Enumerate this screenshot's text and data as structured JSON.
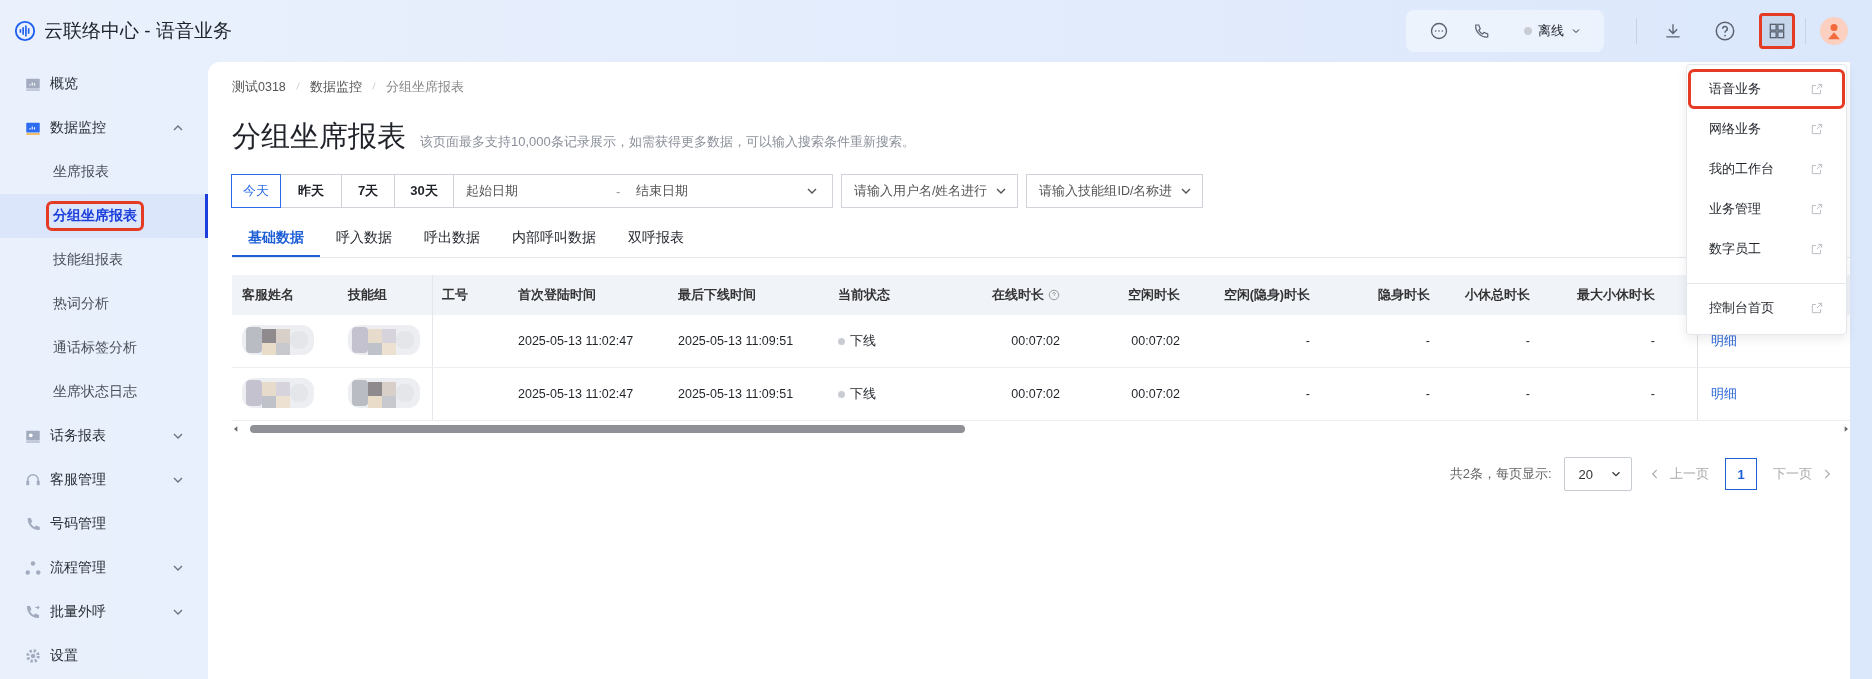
{
  "header": {
    "title": "云联络中心 - 语音业务",
    "agent_status": "离线",
    "apps_button": {
      "highlighted": true
    }
  },
  "sidebar": {
    "items": [
      {
        "label": "概览"
      },
      {
        "label": "数据监控",
        "expanded": true,
        "children": [
          {
            "label": "坐席报表",
            "selected": false,
            "highlighted": false
          },
          {
            "label": "分组坐席报表",
            "selected": true,
            "highlighted": true
          },
          {
            "label": "技能组报表",
            "selected": false,
            "highlighted": false
          },
          {
            "label": "热词分析",
            "selected": false,
            "highlighted": false
          },
          {
            "label": "通话标签分析",
            "selected": false,
            "highlighted": false
          },
          {
            "label": "坐席状态日志",
            "selected": false,
            "highlighted": false
          }
        ]
      },
      {
        "label": "话务报表",
        "expanded": false
      },
      {
        "label": "客服管理",
        "expanded": false
      },
      {
        "label": "号码管理"
      },
      {
        "label": "流程管理",
        "expanded": false
      },
      {
        "label": "批量外呼",
        "expanded": false
      },
      {
        "label": "设置"
      }
    ]
  },
  "breadcrumb": [
    "测试0318",
    "数据监控",
    "分组坐席报表"
  ],
  "page_title": "分组坐席报表",
  "page_note": "该页面最多支持10,000条记录展示，如需获得更多数据，可以输入搜索条件重新搜索。",
  "date_presets": [
    {
      "label": "今天",
      "selected": true
    },
    {
      "label": "昨天",
      "selected": false
    },
    {
      "label": "7天",
      "selected": false
    },
    {
      "label": "30天",
      "selected": false
    }
  ],
  "date_range": {
    "start_placeholder": "起始日期",
    "separator": "-",
    "end_placeholder": "结束日期"
  },
  "user_select": {
    "placeholder": "请输入用户名/姓名进行"
  },
  "skill_select": {
    "placeholder": "请输入技能组ID/名称进"
  },
  "tabs": [
    {
      "label": "基础数据",
      "selected": true
    },
    {
      "label": "呼入数据",
      "selected": false
    },
    {
      "label": "呼出数据",
      "selected": false
    },
    {
      "label": "内部呼叫数据",
      "selected": false
    },
    {
      "label": "双呼报表",
      "selected": false
    }
  ],
  "table": {
    "columns": [
      {
        "label": "客服姓名"
      },
      {
        "label": "技能组"
      },
      {
        "label": "工号"
      },
      {
        "label": "首次登陆时间"
      },
      {
        "label": "最后下线时间"
      },
      {
        "label": "当前状态"
      },
      {
        "label": "在线时长",
        "help": true
      },
      {
        "label": "空闲时长"
      },
      {
        "label": "空闲(隐身)时长"
      },
      {
        "label": "隐身时长"
      },
      {
        "label": "小休总时长"
      },
      {
        "label": "最大小休时长"
      }
    ],
    "rows": [
      {
        "cells": [
          {
            "kind": "picture"
          },
          {
            "kind": "picture"
          },
          {
            "kind": "empty"
          },
          {
            "kind": "text",
            "text": "2025-05-13 11:02:47"
          },
          {
            "kind": "text",
            "text": "2025-05-13 11:09:51"
          },
          {
            "kind": "status",
            "text": "下线"
          },
          {
            "kind": "text",
            "text": "00:07:02"
          },
          {
            "kind": "text",
            "text": "00:07:02"
          },
          {
            "kind": "text",
            "text": "-"
          },
          {
            "kind": "text",
            "text": "-"
          },
          {
            "kind": "text",
            "text": "-"
          },
          {
            "kind": "text",
            "text": "-"
          }
        ],
        "action": "明细"
      },
      {
        "cells": [
          {
            "kind": "picture"
          },
          {
            "kind": "picture"
          },
          {
            "kind": "empty"
          },
          {
            "kind": "text",
            "text": "2025-05-13 11:02:47"
          },
          {
            "kind": "text",
            "text": "2025-05-13 11:09:51"
          },
          {
            "kind": "status",
            "text": "下线"
          },
          {
            "kind": "text",
            "text": "00:07:02"
          },
          {
            "kind": "text",
            "text": "00:07:02"
          },
          {
            "kind": "text",
            "text": "-"
          },
          {
            "kind": "text",
            "text": "-"
          },
          {
            "kind": "text",
            "text": "-"
          },
          {
            "kind": "text",
            "text": "-"
          }
        ],
        "action": "明细"
      }
    ]
  },
  "pagination": {
    "summary": "共2条，每页显示:",
    "page_size": "20",
    "prev": "上一页",
    "pages": [
      {
        "label": "1",
        "selected": true
      }
    ],
    "next": "下一页"
  },
  "app_menu": {
    "items": [
      {
        "label": "语音业务",
        "highlighted": true
      },
      {
        "label": "网络业务",
        "highlighted": false
      },
      {
        "label": "我的工作台",
        "highlighted": false
      },
      {
        "label": "业务管理",
        "highlighted": false
      },
      {
        "label": "数字员工",
        "highlighted": false
      }
    ],
    "footer_items": [
      {
        "label": "控制台首页"
      }
    ]
  }
}
